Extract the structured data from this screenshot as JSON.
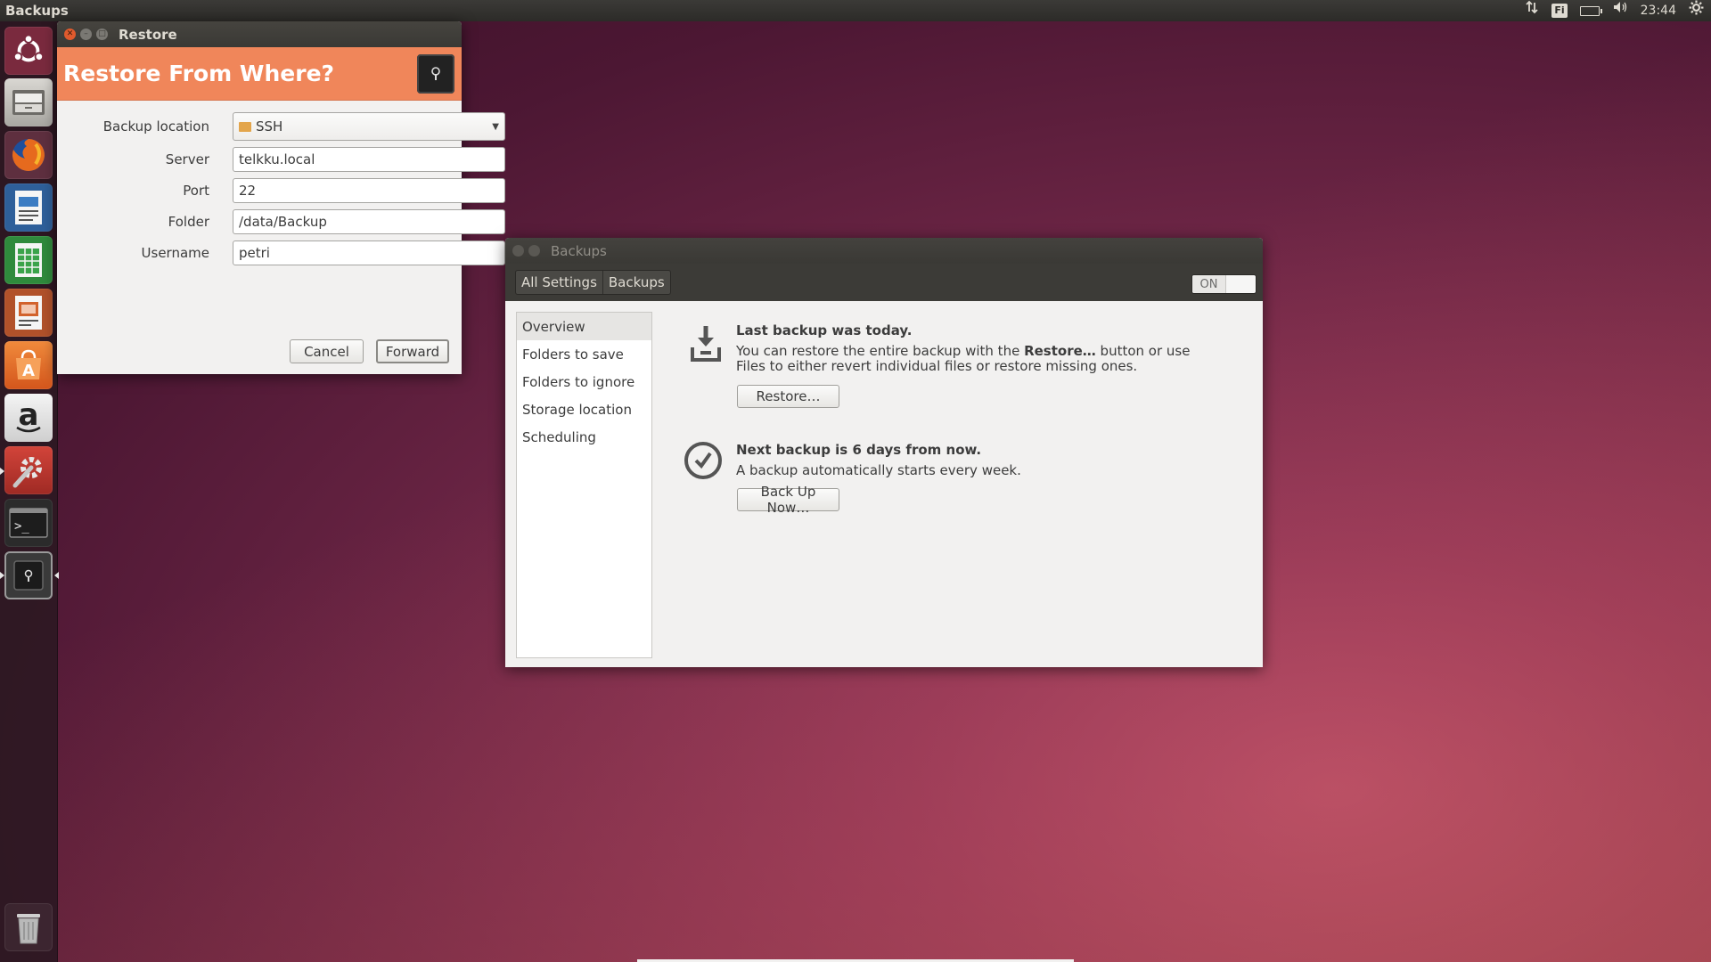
{
  "top_panel": {
    "app_title": "Backups",
    "keyboard_layout": "Fi",
    "clock": "23:44"
  },
  "launcher": {
    "items": [
      {
        "name": "dash",
        "icon": "ubuntu-logo-icon"
      },
      {
        "name": "files",
        "icon": "file-manager-icon"
      },
      {
        "name": "firefox",
        "icon": "firefox-icon"
      },
      {
        "name": "writer",
        "icon": "libreoffice-writer-icon"
      },
      {
        "name": "calc",
        "icon": "libreoffice-calc-icon"
      },
      {
        "name": "impress",
        "icon": "libreoffice-impress-icon"
      },
      {
        "name": "software-center",
        "icon": "software-center-icon"
      },
      {
        "name": "amazon",
        "icon": "amazon-icon"
      },
      {
        "name": "system-settings",
        "icon": "settings-icon"
      },
      {
        "name": "terminal",
        "icon": "terminal-icon"
      },
      {
        "name": "backups",
        "icon": "safe-icon"
      },
      {
        "name": "trash",
        "icon": "trash-icon"
      }
    ],
    "amazon_glyph": "a",
    "terminal_glyph": ">_"
  },
  "restore_dialog": {
    "title": "Restore",
    "heading": "Restore From Where?",
    "fields": {
      "backup_location": {
        "label": "Backup location",
        "value": "SSH"
      },
      "server": {
        "label": "Server",
        "value": "telkku.local"
      },
      "port": {
        "label": "Port",
        "value": "22"
      },
      "folder": {
        "label": "Folder",
        "value": "/data/Backup"
      },
      "username": {
        "label": "Username",
        "value": "petri"
      }
    },
    "buttons": {
      "cancel": "Cancel",
      "forward": "Forward"
    }
  },
  "backups_window": {
    "title": "Backups",
    "breadcrumb": [
      "All Settings",
      "Backups"
    ],
    "switch_label": "ON",
    "sidebar": [
      "Overview",
      "Folders to save",
      "Folders to ignore",
      "Storage location",
      "Scheduling"
    ],
    "selected_item": "Overview",
    "last_backup": {
      "title": "Last backup was today.",
      "text_before": "You can restore the entire backup with the ",
      "text_bold": "Restore…",
      "text_after": " button or use Files to either revert individual files or restore missing ones.",
      "button": "Restore…"
    },
    "next_backup": {
      "title": "Next backup is 6 days from now.",
      "text": "A backup automatically starts every week.",
      "button": "Back Up Now…"
    }
  }
}
